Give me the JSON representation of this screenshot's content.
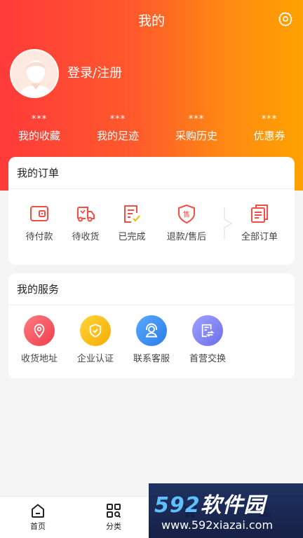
{
  "header": {
    "title": "我的",
    "settings_icon": "gear-icon"
  },
  "profile": {
    "login_text": "登录/注册",
    "avatar_icon": "avatar-icon"
  },
  "stats": [
    {
      "value": "***",
      "label": "我的收藏"
    },
    {
      "value": "***",
      "label": "我的足迹"
    },
    {
      "value": "***",
      "label": "采购历史"
    },
    {
      "value": "***",
      "label": "优惠券"
    }
  ],
  "orders": {
    "title": "我的订单",
    "items": [
      {
        "label": "待付款",
        "icon": "wallet-icon"
      },
      {
        "label": "待收货",
        "icon": "truck-icon"
      },
      {
        "label": "已完成",
        "icon": "completed-icon"
      },
      {
        "label": "退款/售后",
        "icon": "after-sale-icon"
      },
      {
        "label": "全部订单",
        "icon": "all-orders-icon"
      }
    ]
  },
  "services": {
    "title": "我的服务",
    "items": [
      {
        "label": "收货地址",
        "icon": "location-icon",
        "color": "#f0525c"
      },
      {
        "label": "企业认证",
        "icon": "shield-check-icon",
        "color": "#f5b800"
      },
      {
        "label": "联系客服",
        "icon": "customer-service-icon",
        "color": "#3a8ef0"
      },
      {
        "label": "首营交换",
        "icon": "exchange-icon",
        "color": "#7b7ff0"
      }
    ]
  },
  "tabbar": [
    {
      "label": "首页",
      "icon": "home-icon"
    },
    {
      "label": "分类",
      "icon": "category-icon"
    },
    {
      "label": "",
      "icon": "cart-icon"
    },
    {
      "label": "",
      "icon": "profile-icon"
    }
  ],
  "watermark": {
    "logo_prefix": "592",
    "logo_suffix": "软件园",
    "url": "www.592xiazai.com"
  },
  "colors": {
    "accent": "#f24e45",
    "gradient_start": "#ff3a3a",
    "gradient_end": "#ffa200"
  }
}
